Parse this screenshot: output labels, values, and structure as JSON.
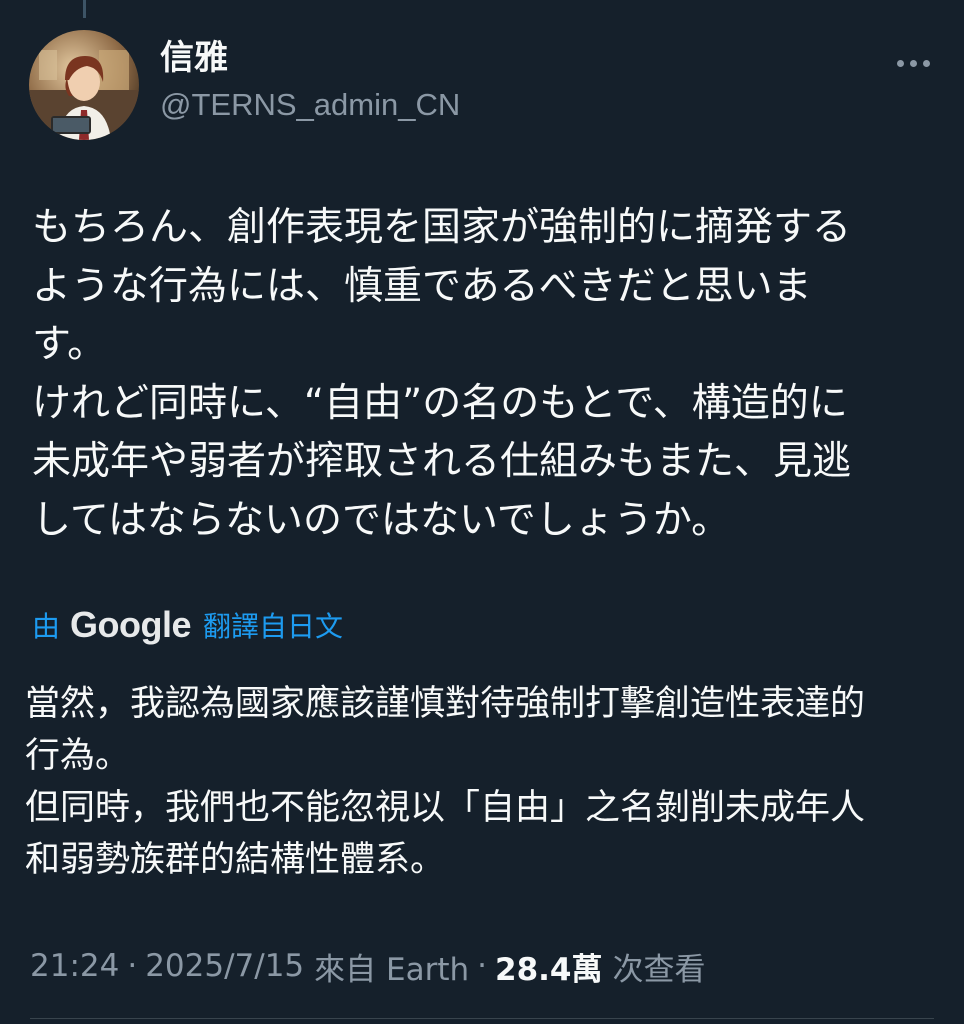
{
  "tweet": {
    "author": {
      "display_name": "信雅",
      "handle": "@TERNS_admin_CN"
    },
    "text_lines": [
      "もちろん、創作表現を国家が強制的に摘発する",
      "ような行為には、慎重であるべきだと思いま",
      "す。",
      "けれど同時に、“自由”の名のもとで、構造的に",
      "未成年や弱者が搾取される仕組みもまた、見逃",
      "してはならないのではないでしょうか。"
    ],
    "translation": {
      "by_label": "由",
      "provider": "Google",
      "link_label": "翻譯自日文",
      "text_lines": [
        "當然，我認為國家應該謹慎對待強制打擊創造性表達的",
        "行為。",
        "但同時，我們也不能忽視以「自由」之名剝削未成年人",
        "和弱勢族群的結構性體系。"
      ]
    },
    "meta": {
      "time": "21:24",
      "separator": "·",
      "date": "2025/7/15",
      "source": "來自 Earth",
      "views_count": "28.4萬",
      "views_label": "次查看"
    }
  },
  "icons": {
    "more": "more-horizontal-icon",
    "avatar": "anime-character-avatar"
  },
  "colors": {
    "background": "#15202b",
    "text_primary": "#f7f9f9",
    "text_secondary": "#8b98a5",
    "link_blue": "#1d9bf0"
  }
}
